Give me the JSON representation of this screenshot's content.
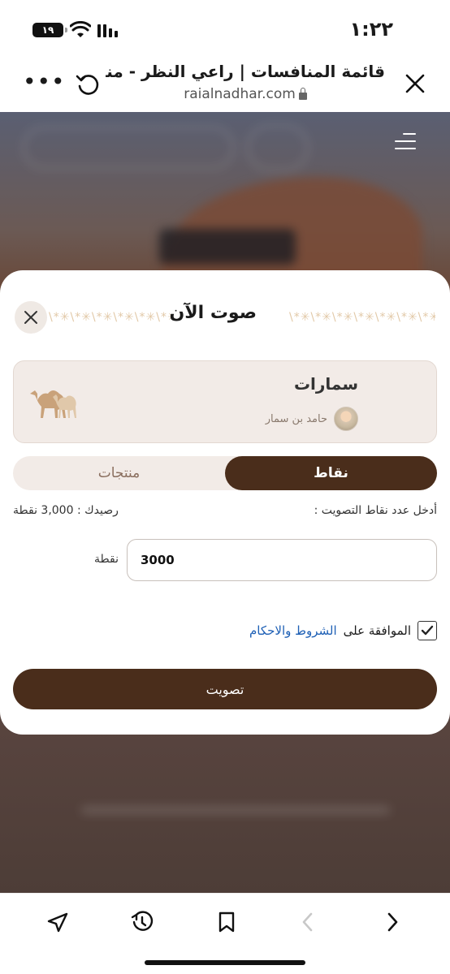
{
  "status_bar": {
    "time": "١:٢٢",
    "battery": "١٩"
  },
  "browser": {
    "title": "قائمة المنافسات | راعي النظر - منق...",
    "url": "raialnadhar.com"
  },
  "modal": {
    "title": "صوت الآن",
    "pattern_text": "\\*✳\\*✳\\*✳\\*✳\\*✳\\*✳\\*✳\\*",
    "entry": {
      "name": "سمارات",
      "owner": "حامد بن سمار"
    },
    "tabs": [
      {
        "label": "نقاط",
        "active": true
      },
      {
        "label": "منتجات",
        "active": false
      }
    ],
    "points_prompt": "أدخل عدد نقاط التصويت :",
    "balance": "رصيدك : 3,000 نقطة",
    "amount_value": "3000",
    "unit": "نقطة",
    "terms_prefix": "الموافقة على",
    "terms_link": "الشروط والاحكام",
    "terms_checked": true,
    "submit_label": "تصويت"
  },
  "icons": {
    "close": "close-icon",
    "reload": "reload-icon",
    "more": "more-icon",
    "share": "share-icon",
    "history": "history-icon",
    "bookmark": "bookmark-icon",
    "back": "chevron-left-icon",
    "forward": "chevron-right-icon"
  },
  "colors": {
    "brand_brown": "#4a2d1b",
    "link_blue": "#1d5fb5",
    "card_bg": "#f2ebe7",
    "pattern_gold": "#e2c9a8"
  }
}
